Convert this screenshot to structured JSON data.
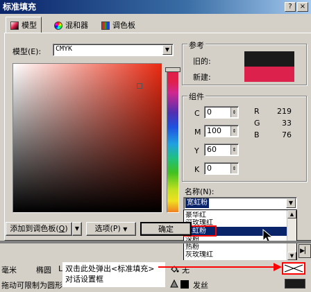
{
  "window": {
    "title": "标准填充",
    "close_label": "×",
    "help_label": "?"
  },
  "tabs": [
    {
      "label": "模型",
      "icon": "color-model-icon"
    },
    {
      "label": "混和器",
      "icon": "color-wheel-icon"
    },
    {
      "label": "调色板",
      "icon": "palette-grid-icon"
    }
  ],
  "model": {
    "label": "模型(E):",
    "value": "CMYK"
  },
  "reference": {
    "label": "参考",
    "old_label": "旧的:",
    "new_label": "新建:",
    "old_color": "#1a1a1a",
    "new_color": "#db214c"
  },
  "components": {
    "label": "组件",
    "c_label": "C",
    "c_value": "0",
    "m_label": "M",
    "m_value": "100",
    "y_label": "Y",
    "y_value": "60",
    "k_label": "K",
    "k_value": "0",
    "r_label": "R",
    "r_value": "219",
    "g_label": "G",
    "g_value": "33",
    "b_label": "B",
    "b_value": "76"
  },
  "name": {
    "label": "名称(N):",
    "value": "宽虹粉",
    "options": [
      "豪华红",
      "深玫瑰红",
      "宽虹粉",
      "深粉",
      "热粉",
      "灰玫瑰红"
    ],
    "selected": "宽虹粉"
  },
  "buttons": {
    "add_palette": "添加到调色板(",
    "add_palette_key": "Q",
    "options": "选项(P)",
    "ok": "确定"
  },
  "underlay": {
    "unit": "毫米",
    "shape": "椭圆",
    "la": "La",
    "hint": "拖动可限制为圆形",
    "none_label": "无",
    "outline_label": "发丝"
  },
  "annotation": {
    "line1": "双击此处弹出<标准填充>",
    "line2": "对话设置框",
    "color": "#ff0000"
  }
}
